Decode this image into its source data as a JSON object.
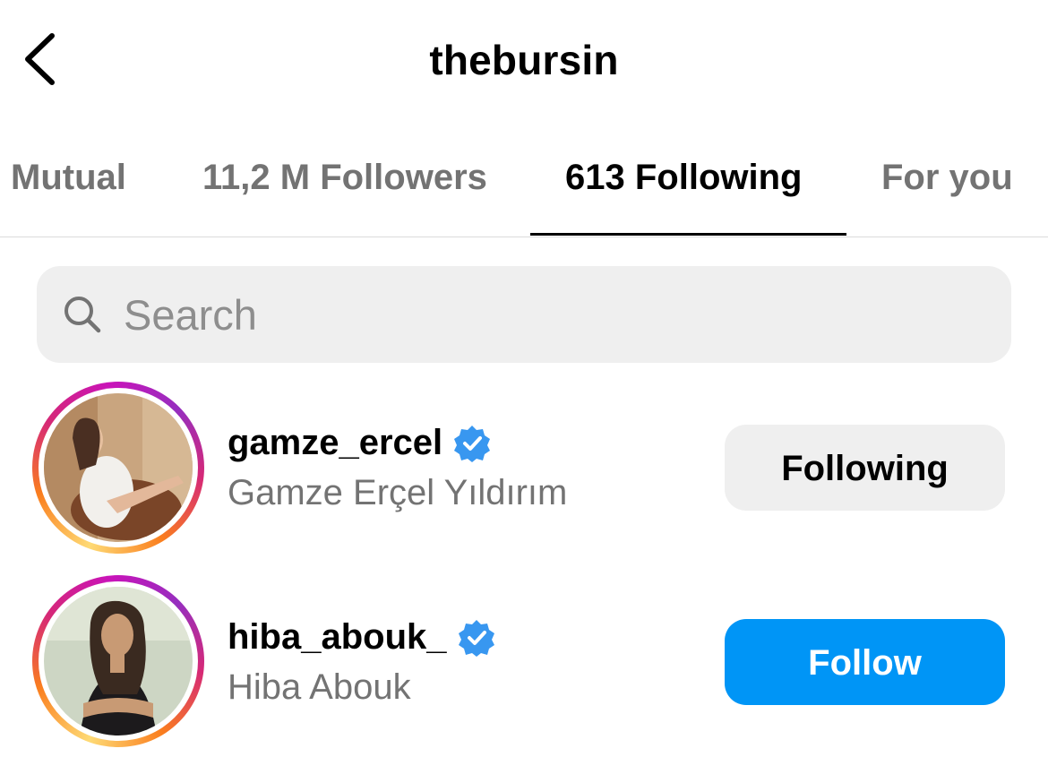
{
  "header": {
    "title": "thebursin",
    "back_icon": "chevron-left-icon"
  },
  "tabs": [
    {
      "label": "Mutual",
      "active": false
    },
    {
      "label": "11,2 M Followers",
      "active": false
    },
    {
      "label": "613 Following",
      "active": true
    },
    {
      "label": "For you",
      "active": false
    }
  ],
  "search": {
    "placeholder": "Search",
    "icon": "search-icon"
  },
  "accounts": [
    {
      "username": "gamze_ercel",
      "full_name": "Gamze Erçel Yıldırım",
      "verified": true,
      "button_label": "Following",
      "button_style": "following"
    },
    {
      "username": "hiba_abouk_",
      "full_name": "Hiba Abouk",
      "verified": true,
      "button_label": "Follow",
      "button_style": "follow"
    }
  ],
  "colors": {
    "accent": "#0095f6",
    "verified": "#3897f0",
    "secondary_text": "#737373",
    "button_gray": "#efefef"
  }
}
